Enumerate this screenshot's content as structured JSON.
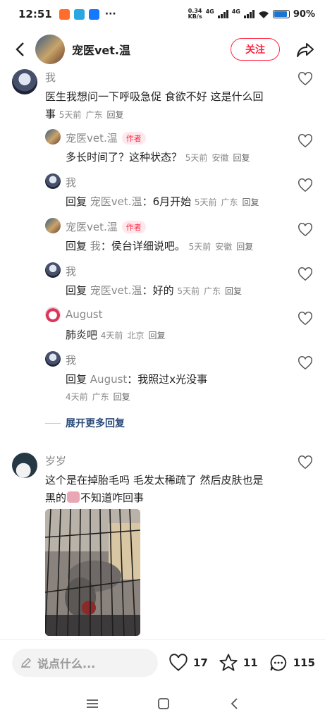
{
  "status": {
    "time": "12:51",
    "net_speed": "0.34",
    "net_unit": "KB/s",
    "net_a": "4G",
    "net_b": "4G",
    "battery": "90%",
    "battery_level": 0.9
  },
  "header": {
    "name": "宠医vet.温",
    "follow_label": "关注",
    "back_icon": "chevron-left-icon",
    "share_icon": "share-icon"
  },
  "comments": [
    {
      "user": "我",
      "text": "医生我想问一下呼吸急促 食欲不好 这是什么回",
      "text2": "事",
      "time": "5天前",
      "loc": "广东",
      "reply": "回复"
    },
    {
      "user": "宠医vet.温",
      "badge": "作者",
      "text": "多长时间了？这种状态？",
      "time": "5天前",
      "loc": "安徽",
      "reply": "回复"
    },
    {
      "user": "我",
      "prefix": "回复",
      "to": "宠医vet.温",
      "text": "：6月开始",
      "time": "5天前",
      "loc": "广东",
      "reply": "回复"
    },
    {
      "user": "宠医vet.温",
      "badge": "作者",
      "prefix": "回复",
      "to": "我",
      "text": "：侯台详细说吧。",
      "time": "5天前",
      "loc": "安徽",
      "reply": "回复"
    },
    {
      "user": "我",
      "prefix": "回复",
      "to": "宠医vet.温",
      "text": "：好的",
      "time": "5天前",
      "loc": "广东",
      "reply": "回复"
    },
    {
      "user": "August",
      "text": "肺炎吧",
      "time": "4天前",
      "loc": "北京",
      "reply": "回复"
    },
    {
      "user": "我",
      "prefix": "回复",
      "to": "August",
      "text": "：我照过x光没事",
      "time": "4天前",
      "loc": "广东",
      "reply": "回复"
    },
    {
      "user": "岁岁",
      "text": "这个是在掉胎毛吗 毛发太稀疏了 然后皮肤也是",
      "text2": "黑的",
      "text3": "不知道咋回事"
    }
  ],
  "more_replies": "展开更多回复",
  "bottom": {
    "placeholder": "说点什么...",
    "likes": "17",
    "collects": "11",
    "comments": "115"
  },
  "colors": {
    "accent": "#ff2442",
    "link": "#2a4b7a"
  }
}
